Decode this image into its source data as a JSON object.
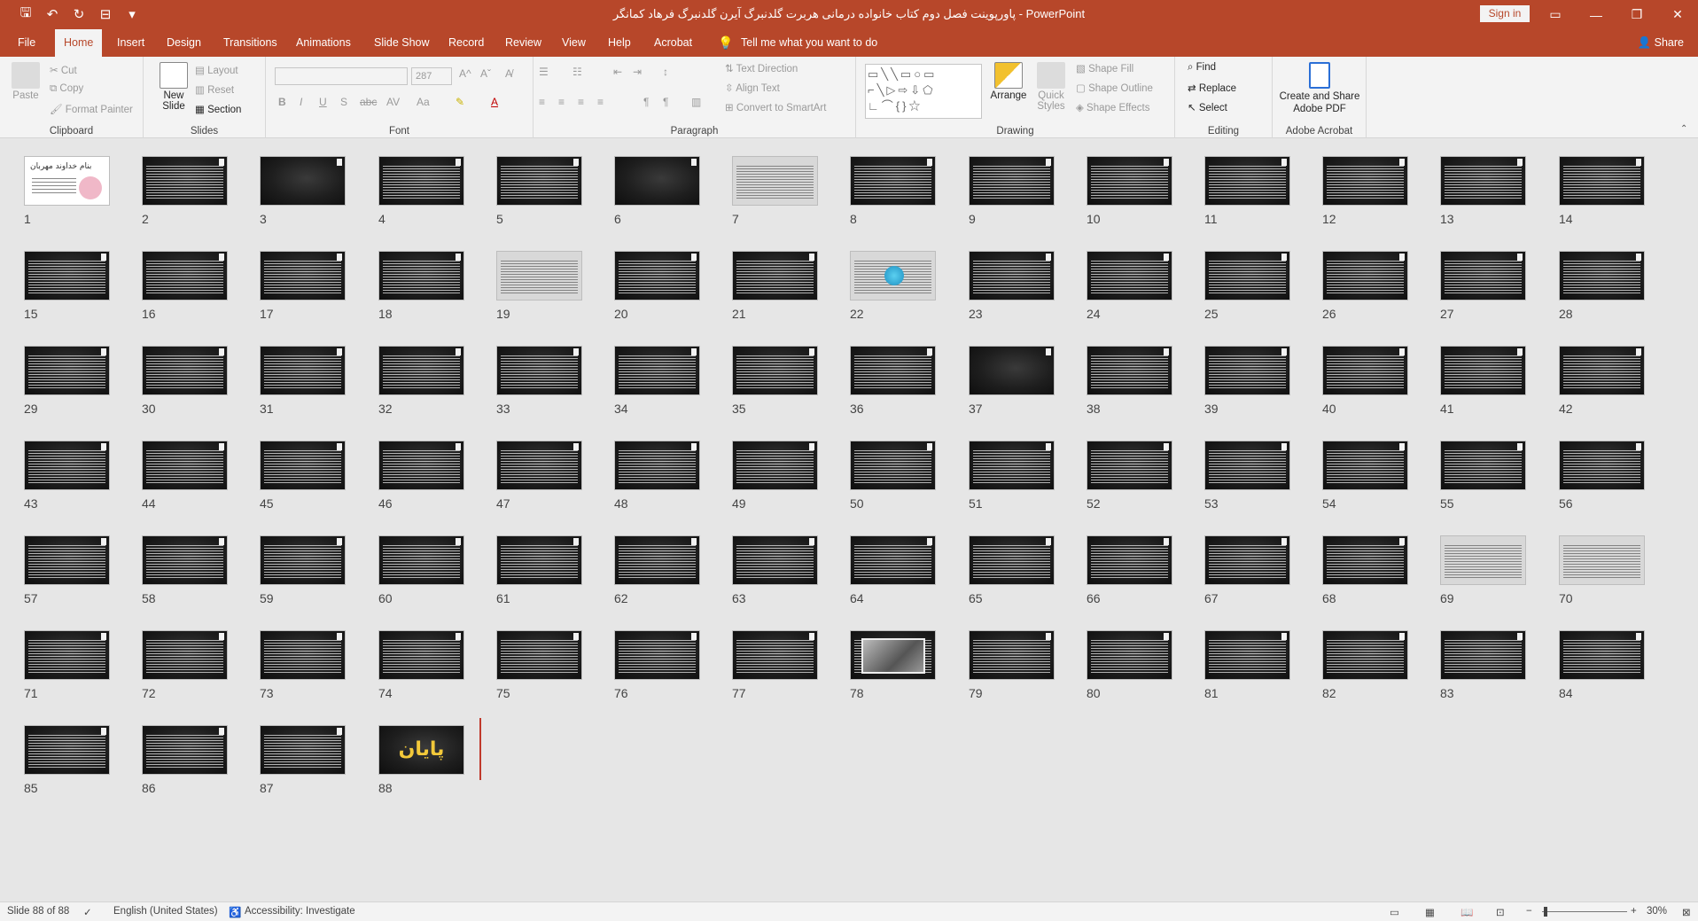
{
  "window": {
    "title": "پاورپوینت فصل دوم کتاب خانواده درمانی هربرت گلدنبرگ آیرن گلدنبرگ فرهاد کمانگر - PowerPoint",
    "signin": "Sign in"
  },
  "tabs": {
    "file": "File",
    "home": "Home",
    "insert": "Insert",
    "design": "Design",
    "transitions": "Transitions",
    "animations": "Animations",
    "slideshow": "Slide Show",
    "record": "Record",
    "review": "Review",
    "view": "View",
    "help": "Help",
    "acrobat": "Acrobat",
    "tellme": "Tell me what you want to do",
    "share": "Share"
  },
  "ribbon": {
    "clipboard": {
      "label": "Clipboard",
      "paste": "Paste",
      "cut": "Cut",
      "copy": "Copy",
      "format_painter": "Format Painter"
    },
    "slides": {
      "label": "Slides",
      "new_slide": "New Slide",
      "layout": "Layout",
      "reset": "Reset",
      "section": "Section"
    },
    "font": {
      "label": "Font",
      "size": "287"
    },
    "paragraph": {
      "label": "Paragraph",
      "text_direction": "Text Direction",
      "align_text": "Align Text",
      "convert_smartart": "Convert to SmartArt"
    },
    "drawing": {
      "label": "Drawing",
      "arrange": "Arrange",
      "quick_styles": "Quick Styles",
      "shape_fill": "Shape Fill",
      "shape_outline": "Shape Outline",
      "shape_effects": "Shape Effects"
    },
    "editing": {
      "label": "Editing",
      "find": "Find",
      "replace": "Replace",
      "select": "Select"
    },
    "acrobat": {
      "label": "Adobe Acrobat",
      "create_share": "Create and Share Adobe PDF"
    }
  },
  "slides": [
    {
      "n": "1",
      "kind": "title1",
      "t": "بنام خداوند مهربان"
    },
    {
      "n": "2",
      "kind": "text"
    },
    {
      "n": "3",
      "kind": "blank"
    },
    {
      "n": "4",
      "kind": "text"
    },
    {
      "n": "5",
      "kind": "text"
    },
    {
      "n": "6",
      "kind": "blank"
    },
    {
      "n": "7",
      "kind": "white"
    },
    {
      "n": "8",
      "kind": "text"
    },
    {
      "n": "9",
      "kind": "text"
    },
    {
      "n": "10",
      "kind": "text"
    },
    {
      "n": "11",
      "kind": "text"
    },
    {
      "n": "12",
      "kind": "text"
    },
    {
      "n": "13",
      "kind": "text"
    },
    {
      "n": "14",
      "kind": "text"
    },
    {
      "n": "15",
      "kind": "text"
    },
    {
      "n": "16",
      "kind": "text"
    },
    {
      "n": "17",
      "kind": "text"
    },
    {
      "n": "18",
      "kind": "text"
    },
    {
      "n": "19",
      "kind": "white"
    },
    {
      "n": "20",
      "kind": "text"
    },
    {
      "n": "21",
      "kind": "text"
    },
    {
      "n": "22",
      "kind": "diag"
    },
    {
      "n": "23",
      "kind": "text"
    },
    {
      "n": "24",
      "kind": "text"
    },
    {
      "n": "25",
      "kind": "text"
    },
    {
      "n": "26",
      "kind": "text"
    },
    {
      "n": "27",
      "kind": "text"
    },
    {
      "n": "28",
      "kind": "text"
    },
    {
      "n": "29",
      "kind": "text"
    },
    {
      "n": "30",
      "kind": "text"
    },
    {
      "n": "31",
      "kind": "text"
    },
    {
      "n": "32",
      "kind": "text"
    },
    {
      "n": "33",
      "kind": "text"
    },
    {
      "n": "34",
      "kind": "text"
    },
    {
      "n": "35",
      "kind": "text"
    },
    {
      "n": "36",
      "kind": "text"
    },
    {
      "n": "37",
      "kind": "blank"
    },
    {
      "n": "38",
      "kind": "text"
    },
    {
      "n": "39",
      "kind": "text"
    },
    {
      "n": "40",
      "kind": "text"
    },
    {
      "n": "41",
      "kind": "text"
    },
    {
      "n": "42",
      "kind": "text"
    },
    {
      "n": "43",
      "kind": "text"
    },
    {
      "n": "44",
      "kind": "text"
    },
    {
      "n": "45",
      "kind": "text"
    },
    {
      "n": "46",
      "kind": "text"
    },
    {
      "n": "47",
      "kind": "text"
    },
    {
      "n": "48",
      "kind": "text"
    },
    {
      "n": "49",
      "kind": "text"
    },
    {
      "n": "50",
      "kind": "text"
    },
    {
      "n": "51",
      "kind": "text"
    },
    {
      "n": "52",
      "kind": "text"
    },
    {
      "n": "53",
      "kind": "text"
    },
    {
      "n": "54",
      "kind": "text"
    },
    {
      "n": "55",
      "kind": "text"
    },
    {
      "n": "56",
      "kind": "text"
    },
    {
      "n": "57",
      "kind": "text"
    },
    {
      "n": "58",
      "kind": "text"
    },
    {
      "n": "59",
      "kind": "text"
    },
    {
      "n": "60",
      "kind": "text"
    },
    {
      "n": "61",
      "kind": "text"
    },
    {
      "n": "62",
      "kind": "text"
    },
    {
      "n": "63",
      "kind": "text"
    },
    {
      "n": "64",
      "kind": "text"
    },
    {
      "n": "65",
      "kind": "text"
    },
    {
      "n": "66",
      "kind": "text"
    },
    {
      "n": "67",
      "kind": "text"
    },
    {
      "n": "68",
      "kind": "text"
    },
    {
      "n": "69",
      "kind": "white"
    },
    {
      "n": "70",
      "kind": "white"
    },
    {
      "n": "71",
      "kind": "text"
    },
    {
      "n": "72",
      "kind": "text"
    },
    {
      "n": "73",
      "kind": "text"
    },
    {
      "n": "74",
      "kind": "text"
    },
    {
      "n": "75",
      "kind": "text"
    },
    {
      "n": "76",
      "kind": "text"
    },
    {
      "n": "77",
      "kind": "text"
    },
    {
      "n": "78",
      "kind": "photo"
    },
    {
      "n": "79",
      "kind": "text"
    },
    {
      "n": "80",
      "kind": "text"
    },
    {
      "n": "81",
      "kind": "text"
    },
    {
      "n": "82",
      "kind": "text"
    },
    {
      "n": "83",
      "kind": "text"
    },
    {
      "n": "84",
      "kind": "text"
    },
    {
      "n": "85",
      "kind": "text"
    },
    {
      "n": "86",
      "kind": "text"
    },
    {
      "n": "87",
      "kind": "text"
    },
    {
      "n": "88",
      "kind": "end",
      "t": "پایان"
    }
  ],
  "status": {
    "slide": "Slide 88 of 88",
    "language": "English (United States)",
    "accessibility": "Accessibility: Investigate",
    "zoom": "30%"
  },
  "colors": {
    "accent": "#b7472a",
    "background": "#e6e6e6"
  }
}
